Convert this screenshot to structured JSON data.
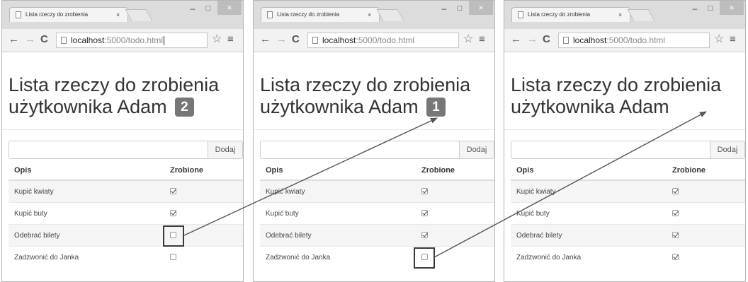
{
  "panels": [
    {
      "tab_title": "Lista rzeczy do zrobienia",
      "url_host": "localhost",
      "url_path": ":5000/todo.html",
      "heading_line1": "Lista rzeczy do zrobienia",
      "heading_line2": "użytkownika Adam",
      "badge": "2",
      "add_button": "Dodaj",
      "columns": {
        "desc": "Opis",
        "done": "Zrobione"
      },
      "items": [
        {
          "desc": "Kupić kwiaty",
          "done": true
        },
        {
          "desc": "Kupić buty",
          "done": true
        },
        {
          "desc": "Odebrać bilety",
          "done": false
        },
        {
          "desc": "Zadzwonić do Janka",
          "done": false
        }
      ]
    },
    {
      "tab_title": "Lista rzeczy do zrobienia",
      "url_host": "localhost",
      "url_path": ":5000/todo.html",
      "heading_line1": "Lista rzeczy do zrobienia",
      "heading_line2": "użytkownika Adam",
      "badge": "1",
      "add_button": "Dodaj",
      "columns": {
        "desc": "Opis",
        "done": "Zrobione"
      },
      "items": [
        {
          "desc": "Kupić kwiaty",
          "done": true
        },
        {
          "desc": "Kupić buty",
          "done": true
        },
        {
          "desc": "Odebrać bilety",
          "done": true
        },
        {
          "desc": "Zadzwonić do Janka",
          "done": false
        }
      ]
    },
    {
      "tab_title": "Lista rzeczy do zrobienia",
      "url_host": "localhost",
      "url_path": ":5000/todo.html",
      "heading_line1": "Lista rzeczy do zrobienia",
      "heading_line2": "użytkownika Adam",
      "badge": "",
      "add_button": "Dodaj",
      "columns": {
        "desc": "Opis",
        "done": "Zrobione"
      },
      "items": [
        {
          "desc": "Kupić kwiaty",
          "done": true
        },
        {
          "desc": "Kupić buty",
          "done": true
        },
        {
          "desc": "Odebrać bilety",
          "done": true
        },
        {
          "desc": "Zadzwonić do Janka",
          "done": true
        }
      ]
    }
  ],
  "icons": {
    "tab_close": "×",
    "minimize": "–",
    "maximize": "□",
    "window_close": "×",
    "back": "←",
    "forward": "→",
    "reload": "C",
    "bookmark": "☆",
    "menu": "≡"
  },
  "colors": {
    "badge": "#777777",
    "arrow": "#555555"
  }
}
